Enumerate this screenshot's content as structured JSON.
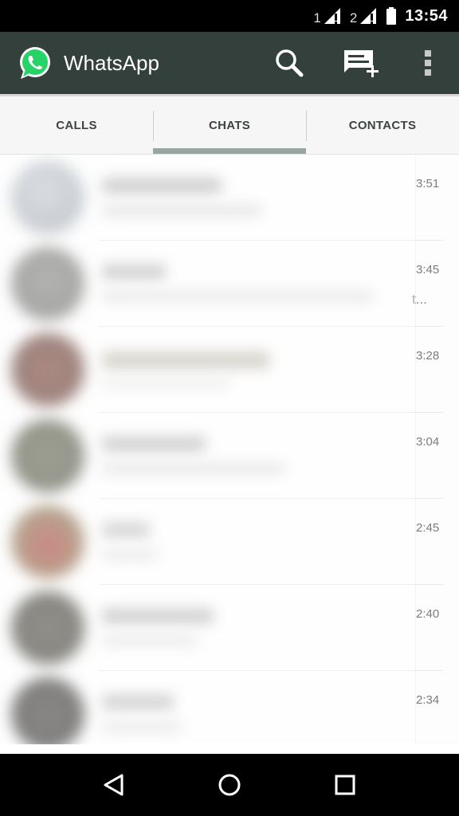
{
  "status_bar": {
    "sim1_label": "1",
    "sim2_label": "2",
    "time": "13:54",
    "icons": [
      "signal-icon",
      "signal-icon",
      "battery-icon"
    ]
  },
  "app_bar": {
    "title": "WhatsApp",
    "logo_icon": "whatsapp-logo-icon",
    "actions": [
      "search-icon",
      "new-chat-icon",
      "overflow-menu-icon"
    ],
    "background": "#34403b"
  },
  "tabs": [
    {
      "label": "CALLS",
      "active": false
    },
    {
      "label": "CHATS",
      "active": true
    },
    {
      "label": "CONTACTS",
      "active": false
    }
  ],
  "chats": [
    {
      "time": "3:51",
      "snippet": ""
    },
    {
      "time": "3:45",
      "snippet": "t..."
    },
    {
      "time": "3:28",
      "snippet": ""
    },
    {
      "time": "3:04",
      "snippet": ""
    },
    {
      "time": "2:45",
      "snippet": ""
    },
    {
      "time": "2:40",
      "snippet": ""
    },
    {
      "time": "2:34",
      "snippet": ""
    }
  ],
  "nav_bar": {
    "buttons": [
      "back-icon",
      "home-icon",
      "recents-icon"
    ]
  },
  "colors": {
    "accent": "#34403b",
    "tab_indicator": "#98a5a0",
    "whatsapp_green": "#25d366"
  }
}
